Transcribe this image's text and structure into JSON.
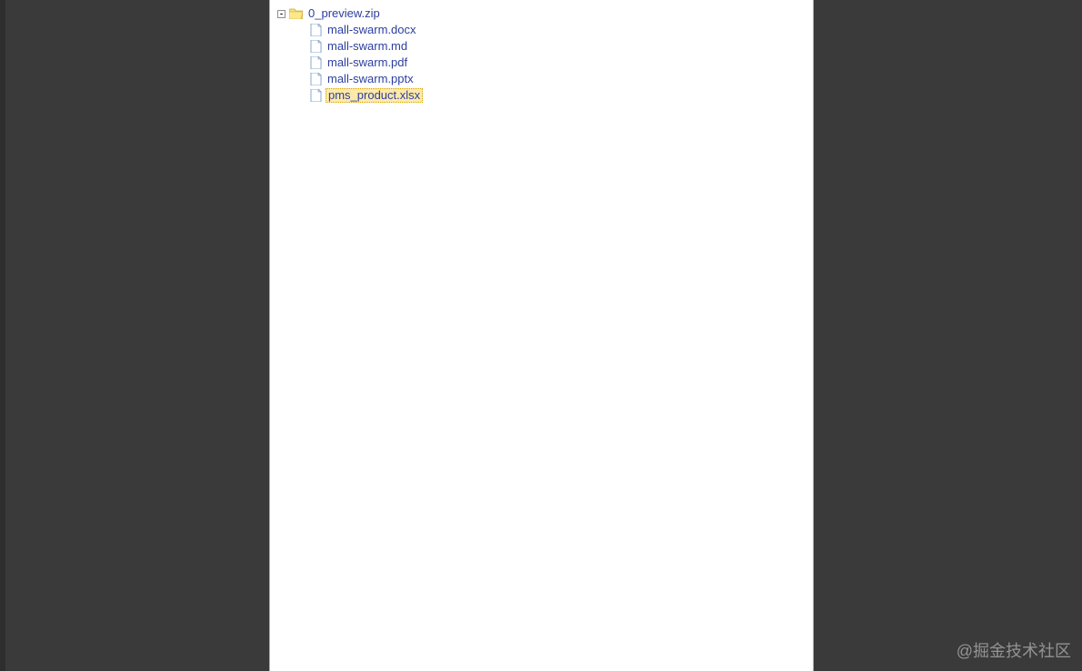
{
  "tree": {
    "root": {
      "label": "0_preview.zip",
      "expanded": true,
      "expand_symbol": "⊟"
    },
    "children": [
      {
        "label": "mall-swarm.docx",
        "selected": false
      },
      {
        "label": "mall-swarm.md",
        "selected": false
      },
      {
        "label": "mall-swarm.pdf",
        "selected": false
      },
      {
        "label": "mall-swarm.pptx",
        "selected": false
      },
      {
        "label": "pms_product.xlsx",
        "selected": true
      }
    ]
  },
  "watermark": "@掘金技术社区"
}
